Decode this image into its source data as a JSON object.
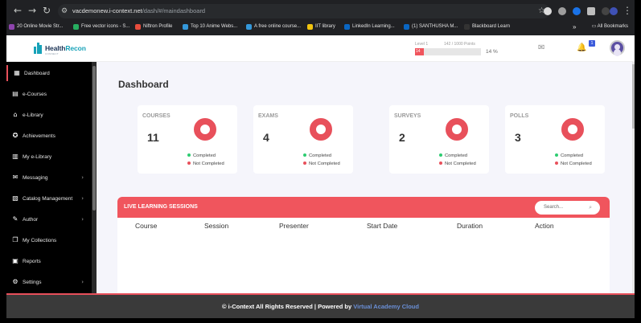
{
  "browser": {
    "url_host": "vacdemonew.i-context.net",
    "url_path": "/dash/#/maindashboard",
    "bookmarks": [
      {
        "label": "20 Online Movie Str...",
        "color": "#8e44ad"
      },
      {
        "label": "Free vector icons - S...",
        "color": "#27ae60"
      },
      {
        "label": "Niftron Profile",
        "color": "#e74c3c"
      },
      {
        "label": "Top 10 Anime Webs...",
        "color": "#3498db"
      },
      {
        "label": "A free online course...",
        "color": "#3498db"
      },
      {
        "label": "IIT library",
        "color": "#f1c40f"
      },
      {
        "label": "LinkedIn Learning...",
        "color": "#0a66c2"
      },
      {
        "label": "(1) SANTHUSHA M...",
        "color": "#0a66c2"
      },
      {
        "label": "Blackboard Learn",
        "color": "#333333"
      }
    ],
    "all_bookmarks": "All Bookmarks"
  },
  "header": {
    "logo_health": "Health",
    "logo_recon": "Recon",
    "logo_sub": "CONNECT",
    "level_label": "Level 1",
    "points_label": "142 / 1000 Points",
    "progress_value": "14 %",
    "progress_percent": "14 %",
    "progress_fraction": 0.14,
    "notification_count": "1"
  },
  "sidebar": {
    "items": [
      {
        "label": "Dashboard",
        "icon": "dashboard-icon"
      },
      {
        "label": "e-Courses",
        "icon": "courses-icon"
      },
      {
        "label": "e-Library",
        "icon": "library-icon"
      },
      {
        "label": "Achievements",
        "icon": "achievements-icon"
      },
      {
        "label": "My e-Library",
        "icon": "my-library-icon"
      },
      {
        "label": "Messaging",
        "icon": "message-icon"
      },
      {
        "label": "Catalog Management",
        "icon": "catalog-icon"
      },
      {
        "label": "Author",
        "icon": "author-icon"
      },
      {
        "label": "My Collections",
        "icon": "collections-icon"
      },
      {
        "label": "Reports",
        "icon": "reports-icon"
      },
      {
        "label": "Settings",
        "icon": "settings-icon"
      }
    ]
  },
  "main": {
    "title": "Dashboard",
    "cards": [
      {
        "label": "COURSES",
        "value": "11",
        "completed": "Completed",
        "not_completed": "Not Completed"
      },
      {
        "label": "EXAMS",
        "value": "4",
        "completed": "Completed",
        "not_completed": "Not Completed"
      },
      {
        "label": "SURVEYS",
        "value": "2",
        "completed": "Completed",
        "not_completed": "Not Completed"
      },
      {
        "label": "POLLS",
        "value": "3",
        "completed": "Completed",
        "not_completed": "Not Completed"
      }
    ],
    "live": {
      "title": "LIVE LEARNING SESSIONS",
      "search_placeholder": "Search...",
      "columns": [
        "Course",
        "Session",
        "Presenter",
        "Start Date",
        "Duration",
        "Action"
      ]
    }
  },
  "footer": {
    "text": "© i-Context All Rights Reserved | Powered by",
    "link": "Virtual Academy Cloud"
  },
  "colors": {
    "accent": "#f0555d",
    "completed": "#2ecc71",
    "not_completed": "#e8505b"
  }
}
